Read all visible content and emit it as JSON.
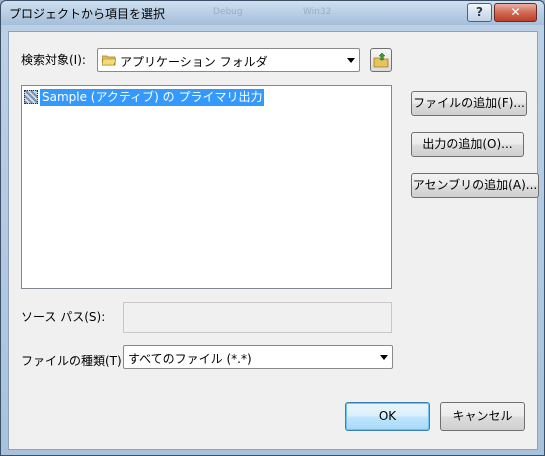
{
  "window": {
    "title": "プロジェクトから項目を選択",
    "help_label": "?",
    "close_label": "✕",
    "ghost_left": "Debug",
    "ghost_right": "Win32"
  },
  "look_in": {
    "label": "検索対象(I):",
    "value": "アプリケーション フォルダ",
    "folder_icon": "folder-icon",
    "up_icon": "folder-up-icon"
  },
  "item_list": {
    "items": [
      "Sample (アクティブ) の プライマリ出力"
    ],
    "selected_index": 0
  },
  "side_buttons": {
    "add_file": "ファイルの追加(F)...",
    "add_output": "出力の追加(O)...",
    "add_assembly": "アセンブリの追加(A)..."
  },
  "source_path": {
    "label": "ソース パス(S):",
    "value": ""
  },
  "file_type": {
    "label": "ファイルの種類(T):",
    "value": "すべてのファイル (*.*)"
  },
  "actions": {
    "ok": "OK",
    "cancel": "キャンセル"
  }
}
